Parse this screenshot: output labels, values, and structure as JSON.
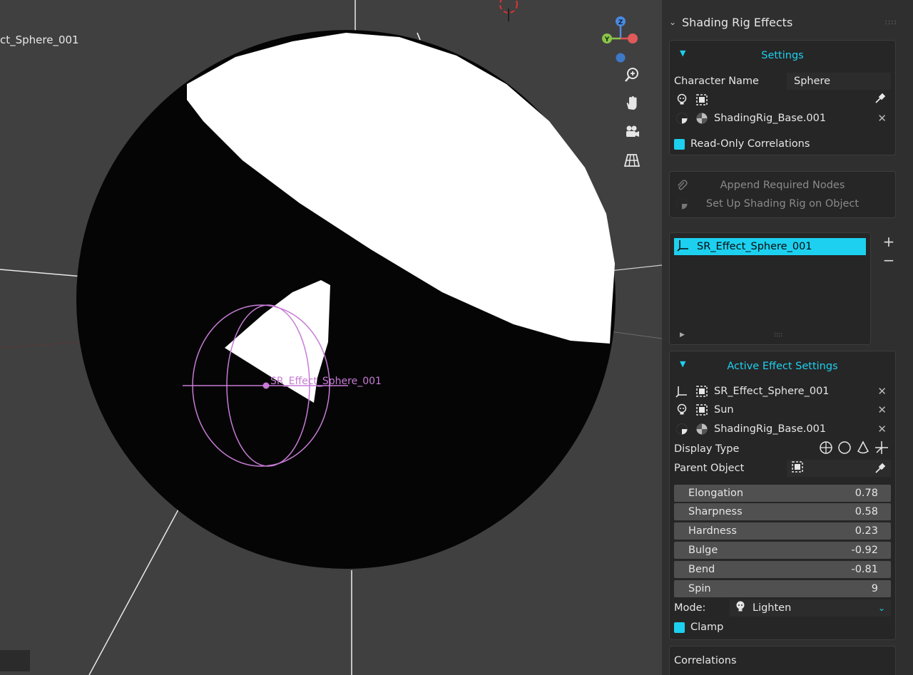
{
  "viewport": {
    "object_label": "ct_Sphere_001",
    "effect_label": "SR_Effect_Sphere_001",
    "gizmo": {
      "z_label": "Z",
      "y_label": "Y"
    },
    "nav_icons": [
      "zoom-icon",
      "hand-icon",
      "camera-icon",
      "grid-icon"
    ]
  },
  "sidebar": {
    "title": "Shading Rig Effects",
    "settings": {
      "header": "Settings",
      "character_name_label": "Character Name",
      "character_name_value": "Sphere",
      "base_object": "ShadingRig_Base.001",
      "read_only_label": "Read-Only Correlations"
    },
    "actions": {
      "append": "Append Required Nodes",
      "setup": "Set Up Shading Rig on Object"
    },
    "effect_list": {
      "items": [
        "SR_Effect_Sphere_001"
      ]
    },
    "active": {
      "header": "Active Effect Settings",
      "effect_name": "SR_Effect_Sphere_001",
      "light_name": "Sun",
      "base_name": "ShadingRig_Base.001",
      "display_type_label": "Display Type",
      "parent_object_label": "Parent Object",
      "props": [
        {
          "name": "Elongation",
          "value": "0.78"
        },
        {
          "name": "Sharpness",
          "value": "0.58"
        },
        {
          "name": "Hardness",
          "value": "0.23"
        },
        {
          "name": "Bulge",
          "value": "-0.92"
        },
        {
          "name": "Bend",
          "value": "-0.81"
        },
        {
          "name": "Spin",
          "value": "9"
        }
      ],
      "mode_label": "Mode:",
      "mode_value": "Lighten",
      "clamp_label": "Clamp"
    },
    "correlations_label": "Correlations"
  },
  "colors": {
    "accent": "#1dd0ef",
    "effect_gizmo": "#c77bd6"
  }
}
